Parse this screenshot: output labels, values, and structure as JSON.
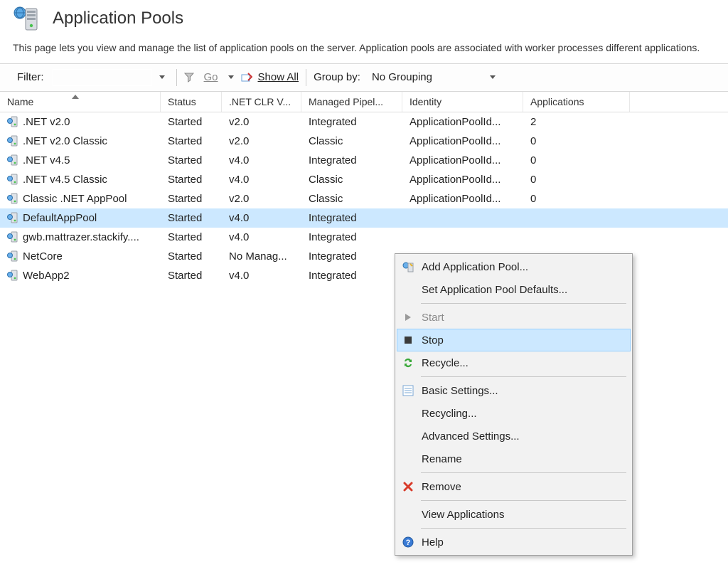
{
  "header": {
    "title": "Application Pools"
  },
  "description": "This page lets you view and manage the list of application pools on the server. Application pools are associated with worker processes different applications.",
  "toolbar": {
    "filter_label": "Filter:",
    "filter_value": "",
    "go_label": "Go",
    "show_all_label": "Show All",
    "group_by_label": "Group by:",
    "grouping_value": "No Grouping"
  },
  "columns": {
    "name": "Name",
    "status": "Status",
    "clr": ".NET CLR V...",
    "pipeline": "Managed Pipel...",
    "identity": "Identity",
    "applications": "Applications"
  },
  "rows": [
    {
      "name": ".NET v2.0",
      "status": "Started",
      "clr": "v2.0",
      "pipeline": "Integrated",
      "identity": "ApplicationPoolId...",
      "apps": "2",
      "selected": false
    },
    {
      "name": ".NET v2.0 Classic",
      "status": "Started",
      "clr": "v2.0",
      "pipeline": "Classic",
      "identity": "ApplicationPoolId...",
      "apps": "0",
      "selected": false
    },
    {
      "name": ".NET v4.5",
      "status": "Started",
      "clr": "v4.0",
      "pipeline": "Integrated",
      "identity": "ApplicationPoolId...",
      "apps": "0",
      "selected": false
    },
    {
      "name": ".NET v4.5 Classic",
      "status": "Started",
      "clr": "v4.0",
      "pipeline": "Classic",
      "identity": "ApplicationPoolId...",
      "apps": "0",
      "selected": false
    },
    {
      "name": "Classic .NET AppPool",
      "status": "Started",
      "clr": "v2.0",
      "pipeline": "Classic",
      "identity": "ApplicationPoolId...",
      "apps": "0",
      "selected": false
    },
    {
      "name": "DefaultAppPool",
      "status": "Started",
      "clr": "v4.0",
      "pipeline": "Integrated",
      "identity": "",
      "apps": "",
      "selected": true
    },
    {
      "name": "gwb.mattrazer.stackify....",
      "status": "Started",
      "clr": "v4.0",
      "pipeline": "Integrated",
      "identity": "",
      "apps": "",
      "selected": false
    },
    {
      "name": "NetCore",
      "status": "Started",
      "clr": "No Manag...",
      "pipeline": "Integrated",
      "identity": "",
      "apps": "",
      "selected": false
    },
    {
      "name": "WebApp2",
      "status": "Started",
      "clr": "v4.0",
      "pipeline": "Integrated",
      "identity": "",
      "apps": "",
      "selected": false
    }
  ],
  "context_menu": {
    "items": [
      {
        "label": "Add Application Pool...",
        "icon": "add-pool-icon",
        "enabled": true
      },
      {
        "label": "Set Application Pool Defaults...",
        "icon": "",
        "enabled": true
      },
      {
        "sep": true
      },
      {
        "label": "Start",
        "icon": "start-icon",
        "enabled": false
      },
      {
        "label": "Stop",
        "icon": "stop-icon",
        "enabled": true,
        "highlight": true
      },
      {
        "label": "Recycle...",
        "icon": "recycle-icon",
        "enabled": true
      },
      {
        "sep": true
      },
      {
        "label": "Basic Settings...",
        "icon": "settings-icon",
        "enabled": true
      },
      {
        "label": "Recycling...",
        "icon": "",
        "enabled": true
      },
      {
        "label": "Advanced Settings...",
        "icon": "",
        "enabled": true
      },
      {
        "label": "Rename",
        "icon": "",
        "enabled": true
      },
      {
        "sep": true
      },
      {
        "label": "Remove",
        "icon": "remove-icon",
        "enabled": true
      },
      {
        "sep": true
      },
      {
        "label": "View Applications",
        "icon": "",
        "enabled": true
      },
      {
        "sep": true
      },
      {
        "label": "Help",
        "icon": "help-icon",
        "enabled": true
      }
    ]
  }
}
